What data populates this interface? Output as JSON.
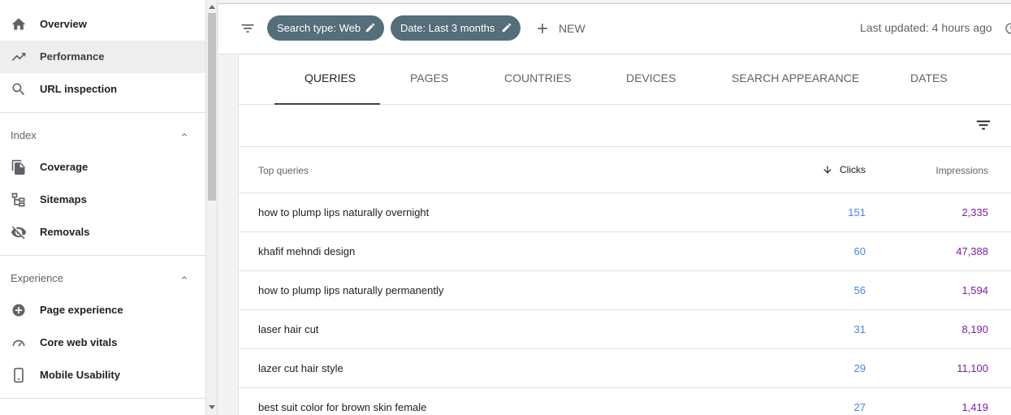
{
  "sidebar": {
    "items": [
      {
        "label": "Overview",
        "icon": "home-icon"
      },
      {
        "label": "Performance",
        "icon": "trending-up-icon"
      },
      {
        "label": "URL inspection",
        "icon": "search-icon"
      }
    ],
    "sections": [
      {
        "title": "Index",
        "items": [
          {
            "label": "Coverage",
            "icon": "copy-icon"
          },
          {
            "label": "Sitemaps",
            "icon": "sitemap-icon"
          },
          {
            "label": "Removals",
            "icon": "eye-off-icon"
          }
        ]
      },
      {
        "title": "Experience",
        "items": [
          {
            "label": "Page experience",
            "icon": "plus-circle-icon"
          },
          {
            "label": "Core web vitals",
            "icon": "speed-gauge-icon"
          },
          {
            "label": "Mobile Usability",
            "icon": "phone-icon"
          }
        ]
      }
    ]
  },
  "toolbar": {
    "chips": [
      {
        "label": "Search type: Web"
      },
      {
        "label": "Date: Last 3 months"
      }
    ],
    "new_label": "NEW",
    "last_updated": "Last updated: 4 hours ago"
  },
  "tabs": [
    "QUERIES",
    "PAGES",
    "COUNTRIES",
    "DEVICES",
    "SEARCH APPEARANCE",
    "DATES"
  ],
  "table": {
    "columns": {
      "query": "Top queries",
      "clicks": "Clicks",
      "impressions": "Impressions"
    },
    "rows": [
      {
        "query": "how to plump lips naturally overnight",
        "clicks": "151",
        "impressions": "2,335"
      },
      {
        "query": "khafif mehndi design",
        "clicks": "60",
        "impressions": "47,388"
      },
      {
        "query": "how to plump lips naturally permanently",
        "clicks": "56",
        "impressions": "1,594"
      },
      {
        "query": "laser hair cut",
        "clicks": "31",
        "impressions": "8,190"
      },
      {
        "query": "lazer cut hair style",
        "clicks": "29",
        "impressions": "11,100"
      },
      {
        "query": "best suit color for brown skin female",
        "clicks": "27",
        "impressions": "1,419"
      }
    ]
  },
  "colors": {
    "chip_bg": "#546e7a",
    "clicks": "#4285f4",
    "impressions": "#7b1fa2",
    "active_nav_bg": "#eeeeee"
  }
}
